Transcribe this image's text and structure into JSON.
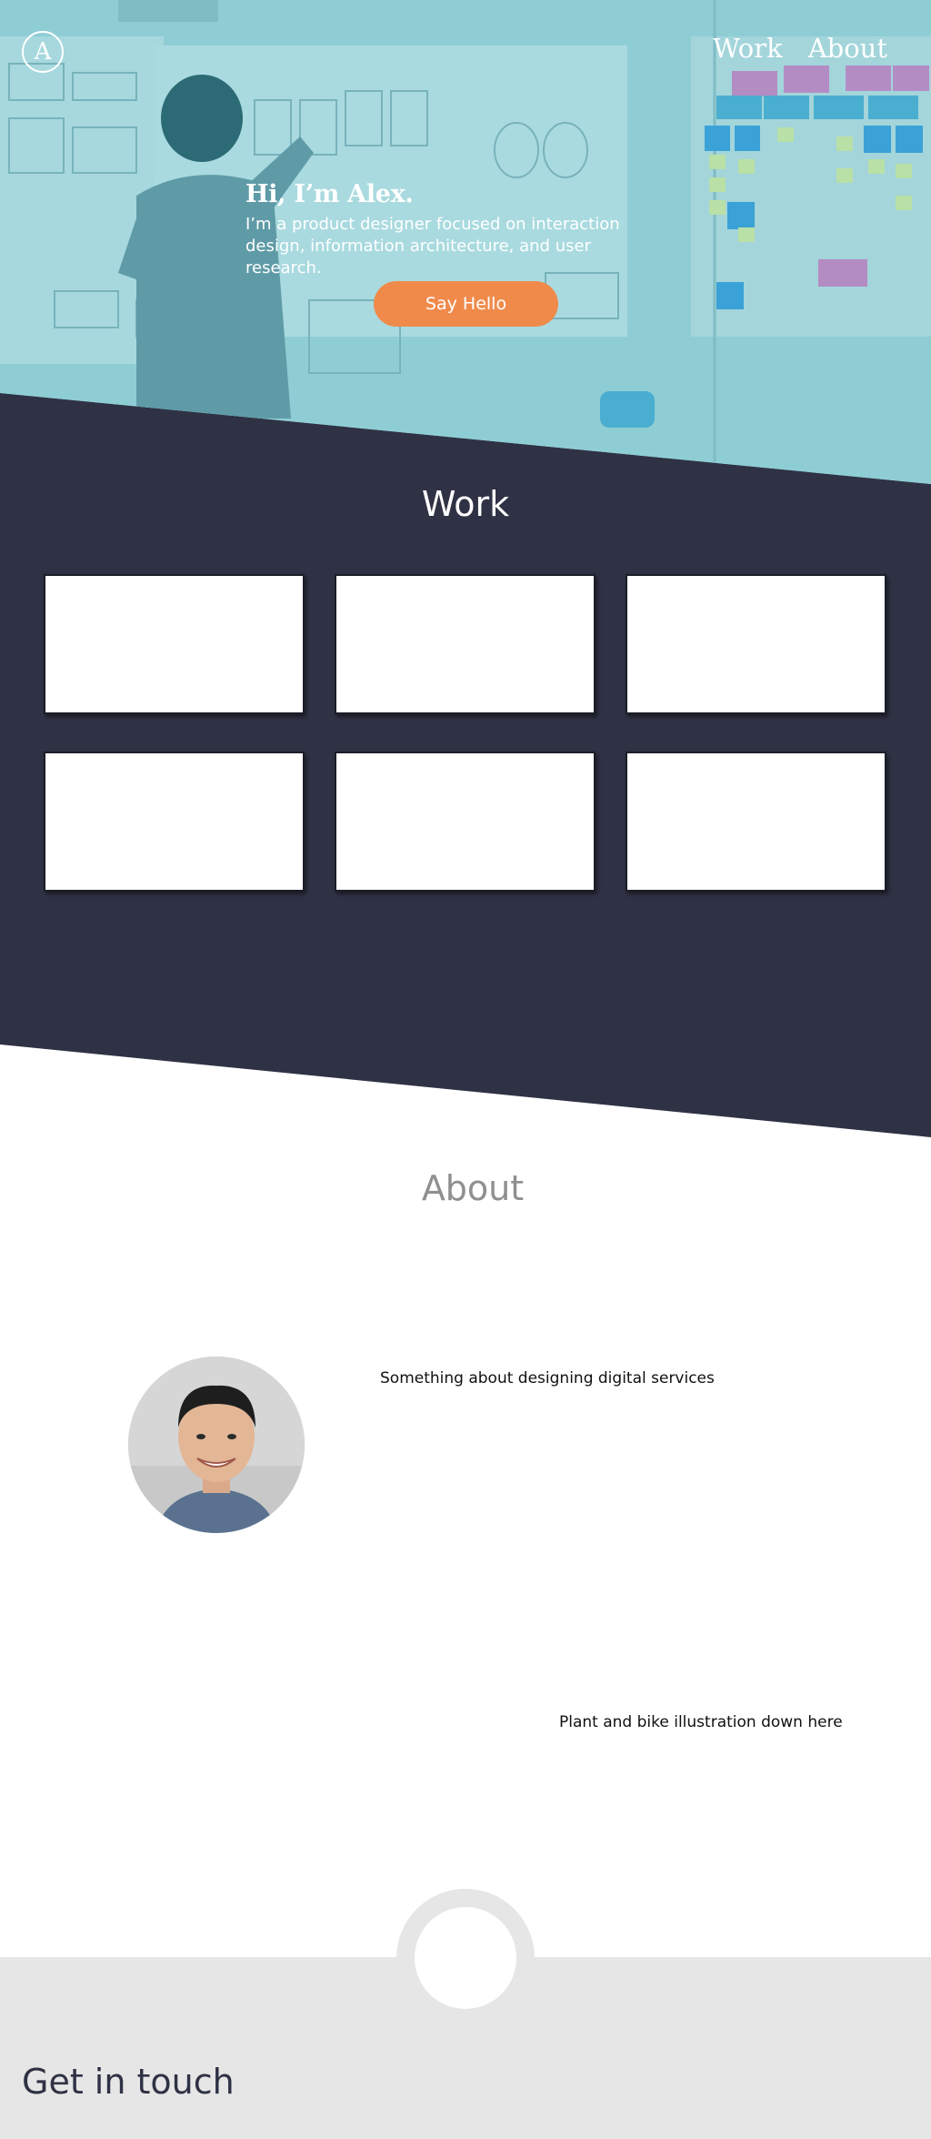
{
  "header": {
    "logo_letter": "A",
    "nav": [
      {
        "label": "Work"
      },
      {
        "label": "About"
      }
    ]
  },
  "hero": {
    "heading": "Hi, I’m Alex.",
    "tagline": "I’m a product designer focused on interaction design, information architecture, and user research.",
    "cta_label": "Say Hello"
  },
  "work": {
    "title": "Work",
    "cards": [
      {},
      {},
      {},
      {},
      {},
      {}
    ]
  },
  "about": {
    "title": "About",
    "text": "Something about designing digital services",
    "illustration_note": "Plant and bike illustration down here"
  },
  "footer": {
    "title": "Get in touch"
  },
  "colors": {
    "hero_tint": "#8ccbd3",
    "work_bg": "#2f3244",
    "accent": "#f08a4b",
    "footer_bg": "#e6e6e6",
    "about_title": "#8f8f8f"
  }
}
